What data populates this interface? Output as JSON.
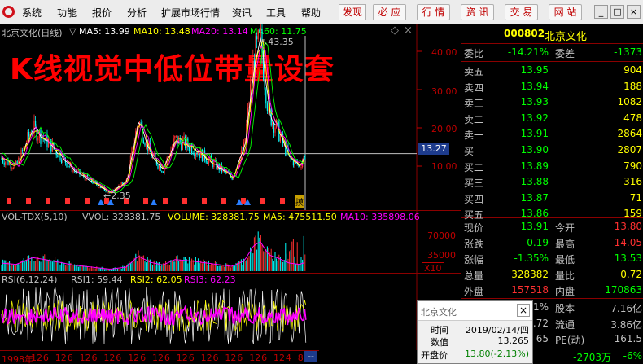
{
  "menu": [
    "系统",
    "功能",
    "报价",
    "分析",
    "扩展市场行情",
    "资讯",
    "工具",
    "帮助"
  ],
  "discover": "发现",
  "quick_buttons": [
    "必 应",
    "行 情",
    "资 讯",
    "交 易",
    "网 站"
  ],
  "window_buttons": [
    "_",
    "□",
    "×"
  ],
  "chart": {
    "title": "北京文化(日线)",
    "title_arrow": "▽",
    "ma5": "MA5: 13.99",
    "ma10": "MA10: 13.48",
    "ma20": "MA20: 13.14",
    "ma60": "MA60: 11.75",
    "overlay_text": "K线视觉中低位带量设套",
    "high_label": "43.35",
    "low_label": "2.35",
    "current_price_tag": "13.27",
    "price_axis": [
      "40.00",
      "30.00",
      "20.00",
      "10.00"
    ],
    "bottom_badge": "摸",
    "vol_title": "VOL-TDX(5,10)",
    "vvol": "VVOL: 328381.75",
    "volume": "VOLUME: 328381.75",
    "vol_ma5": "MA5: 475511.50",
    "vol_ma10": "MA10: 335898.06",
    "vol_axis": [
      "70000",
      "35000"
    ],
    "vol_unit": "X10",
    "rsi_title": "RSI(6,12,24)",
    "rsi1": "RSI1: 59.44",
    "rsi2": "RSI2: 62.05",
    "rsi3": "RSI3: 62.23",
    "timeline": [
      "1998年",
      "12",
      "6",
      "12",
      "6",
      "12",
      "6",
      "12",
      "6",
      "12",
      "6",
      "12",
      "6",
      "12",
      "6",
      "12",
      "6",
      "12",
      "6",
      "12",
      "6",
      "12",
      "4",
      "8"
    ],
    "timeline_end": "--",
    "colors": {
      "ma5": "#ffffff",
      "ma10": "#ffff00",
      "ma20": "#ff00ff",
      "ma60": "#00ff00",
      "up": "#ff3030",
      "down": "#00ffff",
      "overlay": "#ff0000"
    }
  },
  "quote": {
    "code": "000802",
    "name": "北京文化",
    "weibi_label": "委比",
    "weibi": "-14.21%",
    "weicha_label": "委差",
    "weicha": "-1373",
    "asks": [
      {
        "label": "卖五",
        "price": "13.95",
        "vol": "904"
      },
      {
        "label": "卖四",
        "price": "13.94",
        "vol": "188"
      },
      {
        "label": "卖三",
        "price": "13.93",
        "vol": "1082"
      },
      {
        "label": "卖二",
        "price": "13.92",
        "vol": "478"
      },
      {
        "label": "卖一",
        "price": "13.91",
        "vol": "2864"
      }
    ],
    "bids": [
      {
        "label": "买一",
        "price": "13.90",
        "vol": "2807"
      },
      {
        "label": "买二",
        "price": "13.89",
        "vol": "790"
      },
      {
        "label": "买三",
        "price": "13.88",
        "vol": "316"
      },
      {
        "label": "买四",
        "price": "13.87",
        "vol": "71"
      },
      {
        "label": "买五",
        "price": "13.86",
        "vol": "159"
      }
    ],
    "stats": [
      {
        "l1": "现价",
        "v1": "13.91",
        "l2": "今开",
        "v2": "13.80"
      },
      {
        "l1": "涨跌",
        "v1": "-0.19",
        "l2": "最高",
        "v2": "14.05"
      },
      {
        "l1": "涨幅",
        "v1": "-1.35%",
        "l2": "最低",
        "v2": "13.53"
      },
      {
        "l1": "总量",
        "v1": "328382",
        "l2": "量比",
        "v2": "0.72"
      },
      {
        "l1": "外盘",
        "v1": "157518",
        "l2": "内盘",
        "v2": "170863"
      }
    ],
    "extra": [
      {
        "v1": "1%",
        "l2": "股本",
        "v2": "7.16亿"
      },
      {
        "v1": ".72",
        "l2": "流通",
        "v2": "3.86亿"
      },
      {
        "v1": "65",
        "l2": "PE(动)",
        "v2": "161.5"
      }
    ],
    "footer_left": "-2703万",
    "footer_right": "-6%"
  },
  "tooltip": {
    "title": "北京文化",
    "close": "×",
    "time_label": "时间",
    "time_value": "2019/02/14/四",
    "value_label": "数值",
    "value_value": "13.265",
    "open_label": "开盘价",
    "open_value": "13.80(-2.13%)"
  }
}
